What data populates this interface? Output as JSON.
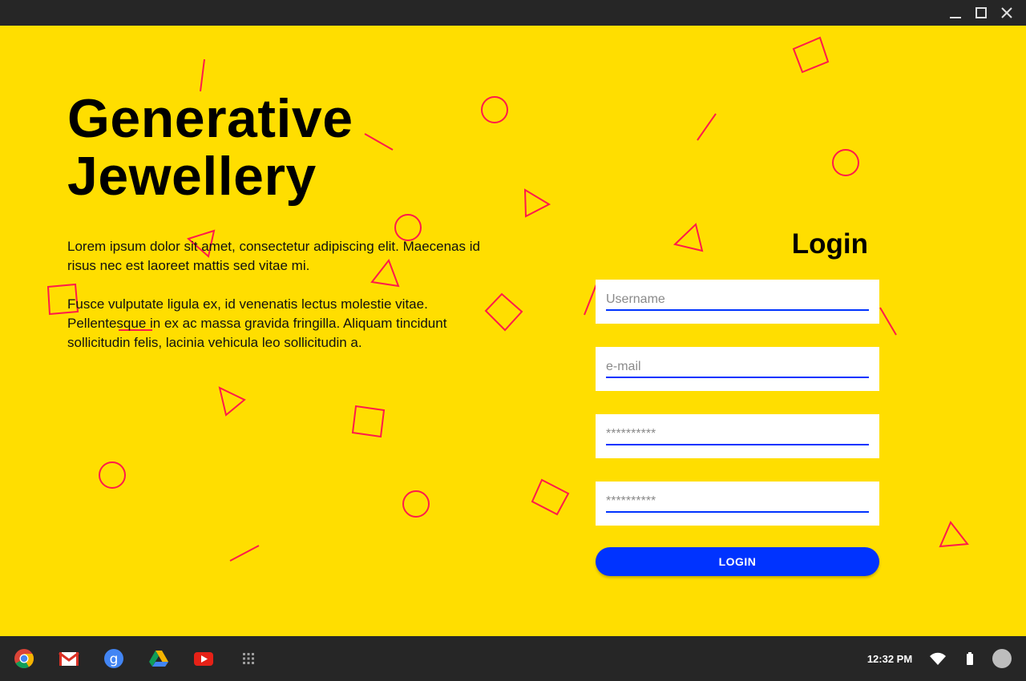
{
  "window": {
    "controls": [
      "minimize-icon",
      "maximize-icon",
      "close-icon"
    ]
  },
  "hero": {
    "title_line1": "Generative",
    "title_line2": "Jewellery",
    "paragraph1": "Lorem ipsum dolor sit amet, consectetur adipiscing elit. Maecenas id risus nec est laoreet mattis sed vitae mi.",
    "paragraph2": "Fusce vulputate ligula ex, id venenatis lectus molestie vitae. Pellentesque in ex ac massa gravida fringilla. Aliquam tincidunt sollicitudin felis, lacinia vehicula leo sollicitudin a."
  },
  "login": {
    "heading": "Login",
    "username_placeholder": "Username",
    "email_placeholder": "e-mail",
    "password_placeholder": "**********",
    "confirm_password_placeholder": "**********",
    "button_label": "LOGIN"
  },
  "shelf": {
    "apps": [
      "chrome-icon",
      "gmail-icon",
      "google-search-icon",
      "google-drive-icon",
      "youtube-icon",
      "app-launcher-icon"
    ],
    "clock": "12:32 PM",
    "tray": [
      "wifi-icon",
      "battery-icon",
      "avatar"
    ]
  },
  "colors": {
    "background": "#FFDE00",
    "accent": "#0033FF",
    "decoration": "#FF1A4B",
    "chrome_bar": "#262626"
  }
}
